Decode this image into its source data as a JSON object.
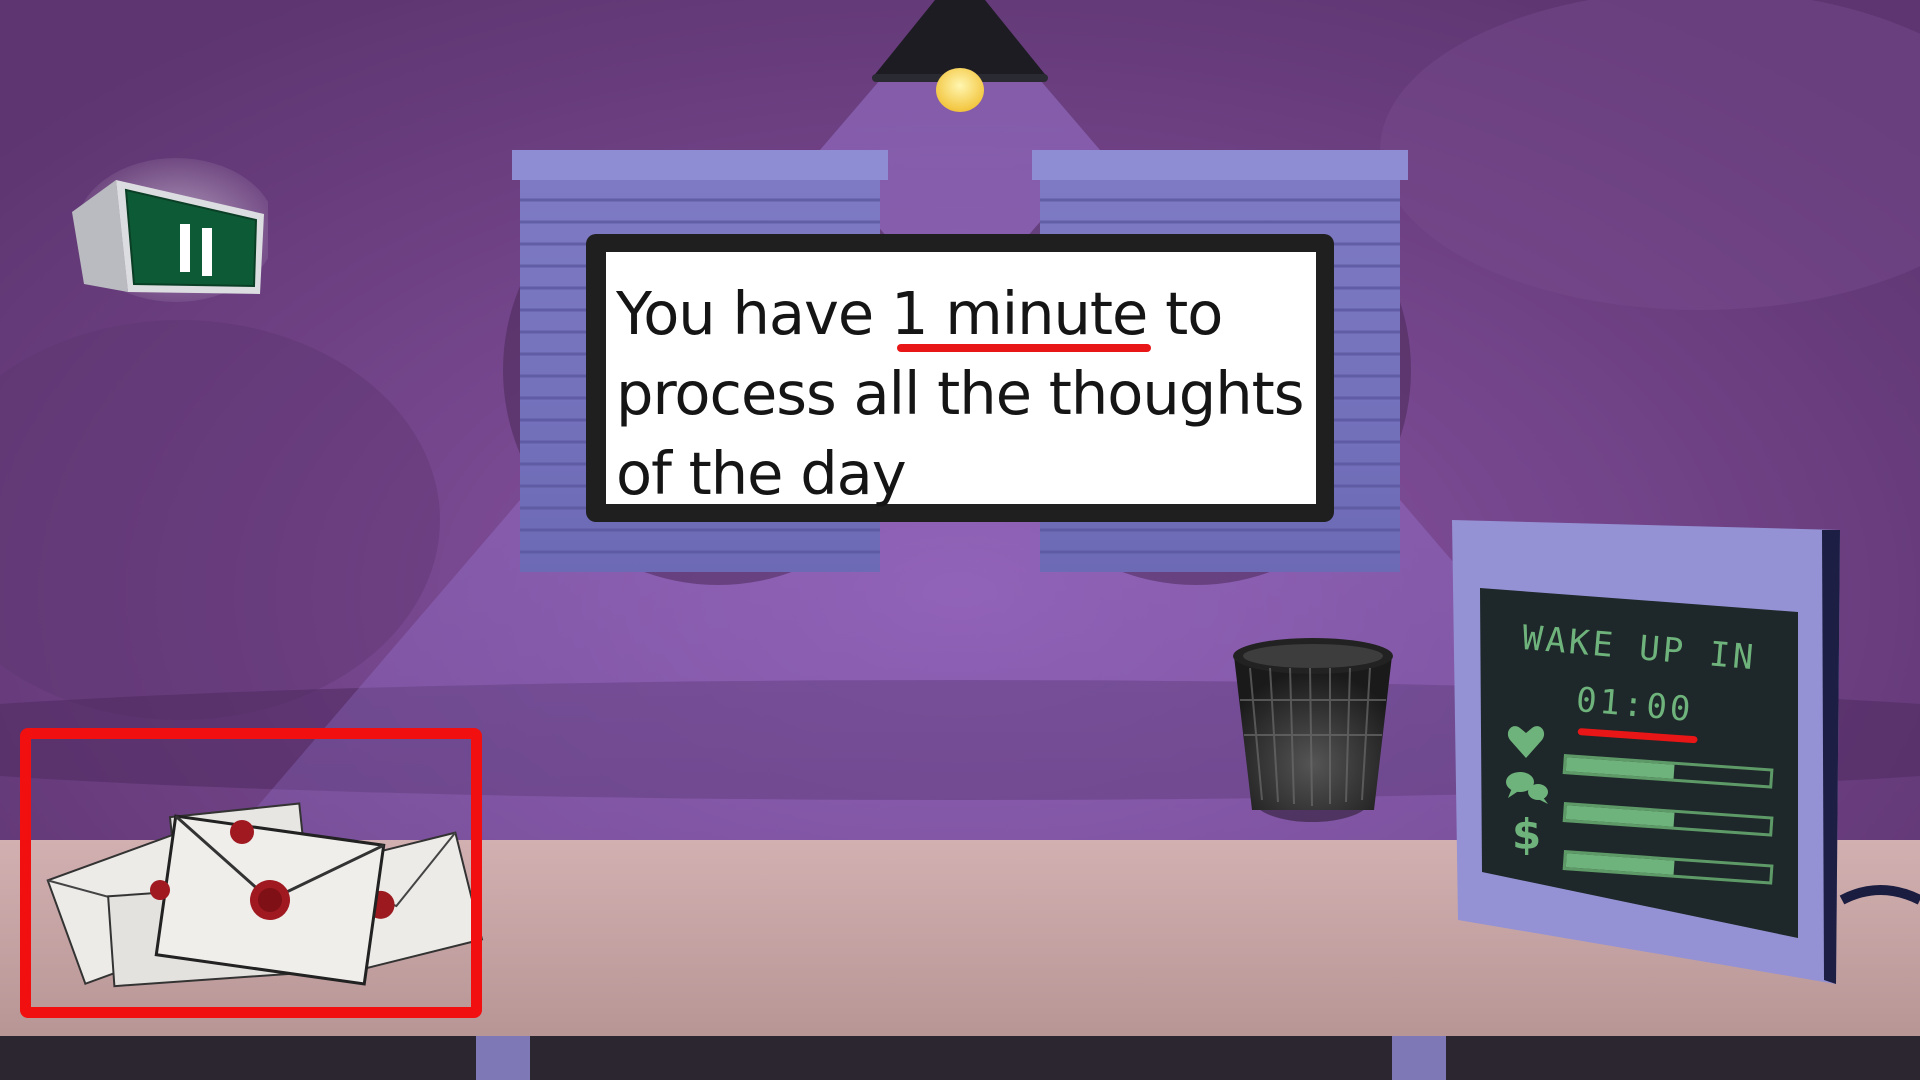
{
  "tutorial_message": {
    "line1_pre": "You have ",
    "line1_highlight": "1 minute",
    "line1_post": " to",
    "line2": "process all the thoughts",
    "line3": "of the day"
  },
  "monitor": {
    "title": "WAKE UP IN",
    "timer": "01:00",
    "stats": [
      {
        "icon": "heart-icon",
        "level": 0.53
      },
      {
        "icon": "chat-bubbles-icon",
        "level": 0.53
      },
      {
        "icon": "dollar-icon",
        "glyph": "$",
        "level": 0.53
      }
    ]
  },
  "pause_button": {
    "icon": "pause-icon"
  },
  "letters_highlight": {
    "color": "#f10f0f"
  },
  "colors": {
    "wall": "#6a3c7e",
    "desk": "#c9a8a8",
    "screen_text": "#6fb37c",
    "highlight": "#e81616"
  }
}
